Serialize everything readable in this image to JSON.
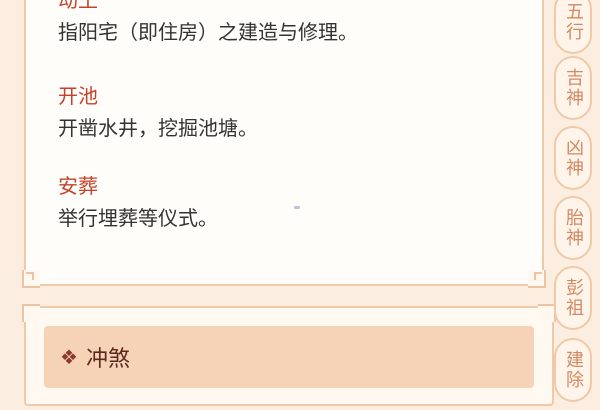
{
  "entries": [
    {
      "term": "动土",
      "desc": "指阳宅（即住房）之建造与修理。"
    },
    {
      "term": "开池",
      "desc": "开凿水井，挖掘池塘。"
    },
    {
      "term": "安葬",
      "desc": "举行埋葬等仪式。"
    }
  ],
  "section": {
    "icon": "❖",
    "title": "冲煞"
  },
  "sidenav": {
    "items": [
      "五行",
      "吉神",
      "凶神",
      "胎神",
      "彭祖",
      "建除"
    ]
  },
  "colors": {
    "term": "#c4422b",
    "text": "#333333",
    "border": "#f0c9a8",
    "header_bg": "#f6d2b7"
  }
}
